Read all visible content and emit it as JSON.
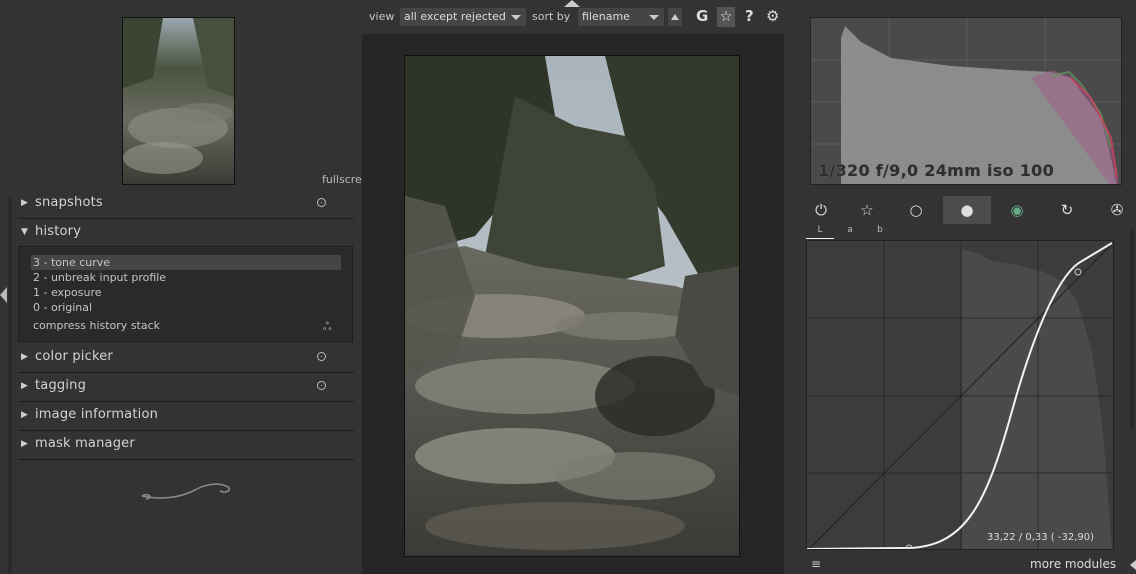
{
  "left": {
    "modules": [
      {
        "label": "snapshots",
        "expanded": false,
        "pinned": true
      },
      {
        "label": "history",
        "expanded": true,
        "pinned": false
      },
      {
        "label": "color picker",
        "expanded": false,
        "pinned": true
      },
      {
        "label": "tagging",
        "expanded": false,
        "pinned": true
      },
      {
        "label": "image information",
        "expanded": false,
        "pinned": false
      },
      {
        "label": "mask manager",
        "expanded": false,
        "pinned": false
      }
    ],
    "history_items": [
      {
        "label": "3 - tone curve",
        "selected": true
      },
      {
        "label": "2 - unbreak input profile",
        "selected": false
      },
      {
        "label": "1 - exposure",
        "selected": false
      },
      {
        "label": "0 - original",
        "selected": false
      }
    ],
    "compress_label": "compress history stack",
    "zoom_icon": "fullscreen-icon ▾"
  },
  "toolbar": {
    "view_label": "view",
    "view_value": "all except rejected",
    "sort_label": "sort by",
    "sort_value": "filename",
    "grouping_icon": "G",
    "help_icon": "?",
    "prefs_icon": "⚙",
    "star_icon": "☆"
  },
  "right": {
    "exif": "1/320 f/9,0 24mm iso 100",
    "groups": [
      {
        "icon": "power-icon",
        "glyph": "⏻",
        "active": false
      },
      {
        "icon": "favorite-icon",
        "glyph": "☆",
        "active": false
      },
      {
        "icon": "basic-circle-icon",
        "glyph": "○",
        "active": false
      },
      {
        "icon": "tone-icon",
        "glyph": "●",
        "active": true
      },
      {
        "icon": "color-icon",
        "glyph": "◉",
        "active": false
      },
      {
        "icon": "correct-icon",
        "glyph": "↻",
        "active": false
      },
      {
        "icon": "effect-icon",
        "glyph": "✇",
        "active": false
      }
    ],
    "curve_tabs": [
      "L",
      "a",
      "b"
    ],
    "curve_readout": "33,22 / 0,33 ( -32,90)",
    "bottom_menu": "≡",
    "more_modules": "more modules"
  },
  "colors": {
    "accent": "#ffffff",
    "panel_bg": "#333333",
    "center_bg": "#262626"
  }
}
